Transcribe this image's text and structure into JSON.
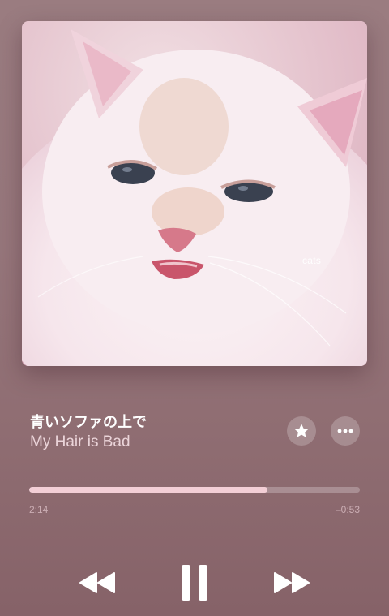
{
  "artwork": {
    "caption": "cats",
    "subject": "white-fluffy-cat-photo"
  },
  "track": {
    "title": "青いソファの上で",
    "artist": "My Hair is Bad"
  },
  "actions": {
    "favorite_icon": "star-icon",
    "more_icon": "ellipsis-icon"
  },
  "playback": {
    "elapsed": "2:14",
    "remaining": "–0:53",
    "progress_fraction": 0.72,
    "progress_color": "#f3cfd6"
  },
  "controls": {
    "rewind_icon": "rewind-icon",
    "pause_icon": "pause-icon",
    "forward_icon": "fast-forward-icon"
  }
}
